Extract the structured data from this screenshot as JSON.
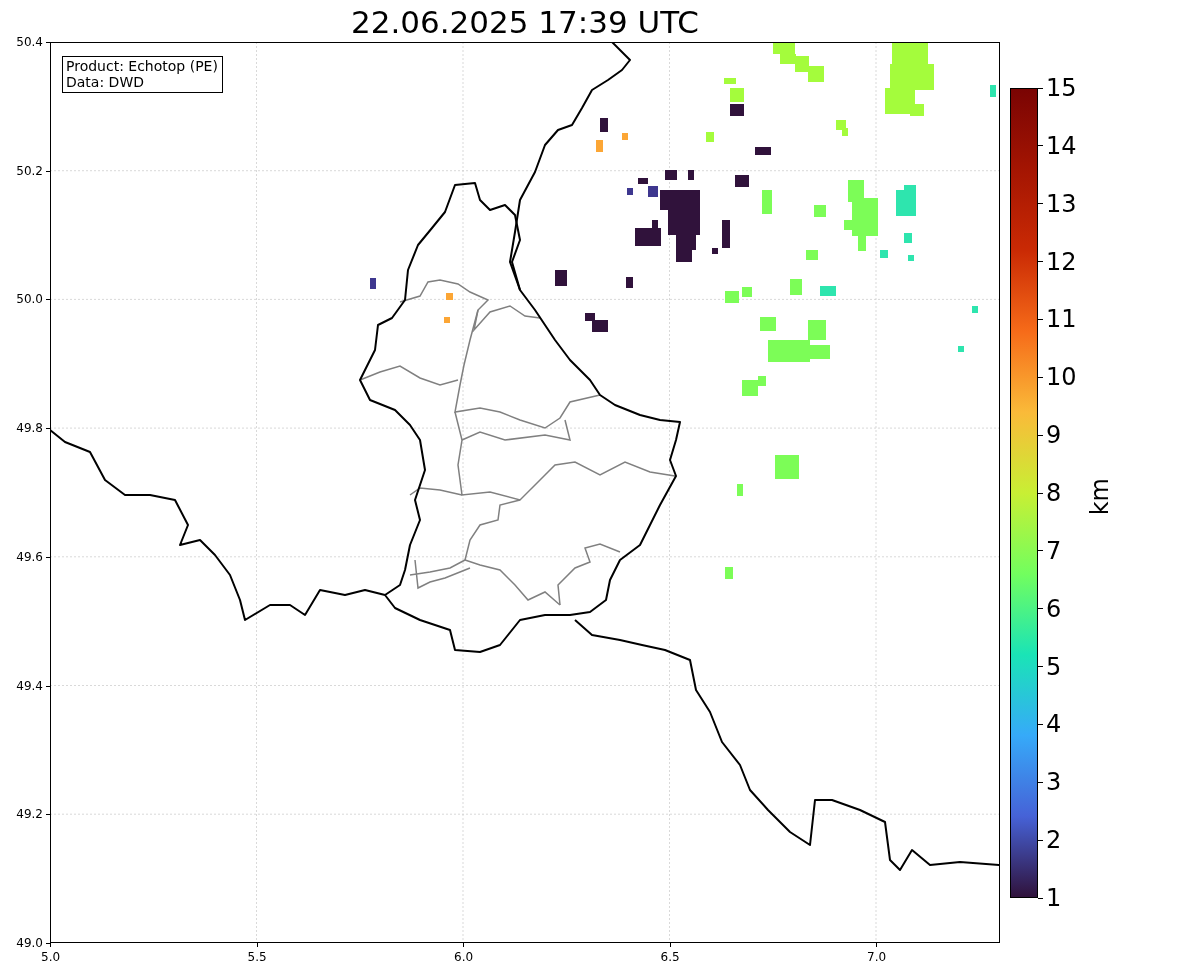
{
  "title": "22.06.2025 17:39 UTC",
  "info_box": {
    "lines": [
      "Product: Echotop (PE)",
      "Data: DWD"
    ]
  },
  "x_axis": {
    "ticks": [
      "5.0",
      "5.5",
      "6.0",
      "6.5",
      "7.0"
    ]
  },
  "y_axis": {
    "ticks": [
      "50.4",
      "50.2",
      "50.0",
      "49.8",
      "49.6",
      "49.4",
      "49.2",
      "49.0"
    ]
  },
  "colorbar": {
    "label": "km",
    "ticks": [
      "15",
      "14",
      "13",
      "12",
      "11",
      "10",
      "9",
      "8",
      "7",
      "6",
      "5",
      "4",
      "3",
      "2",
      "1"
    ]
  }
}
